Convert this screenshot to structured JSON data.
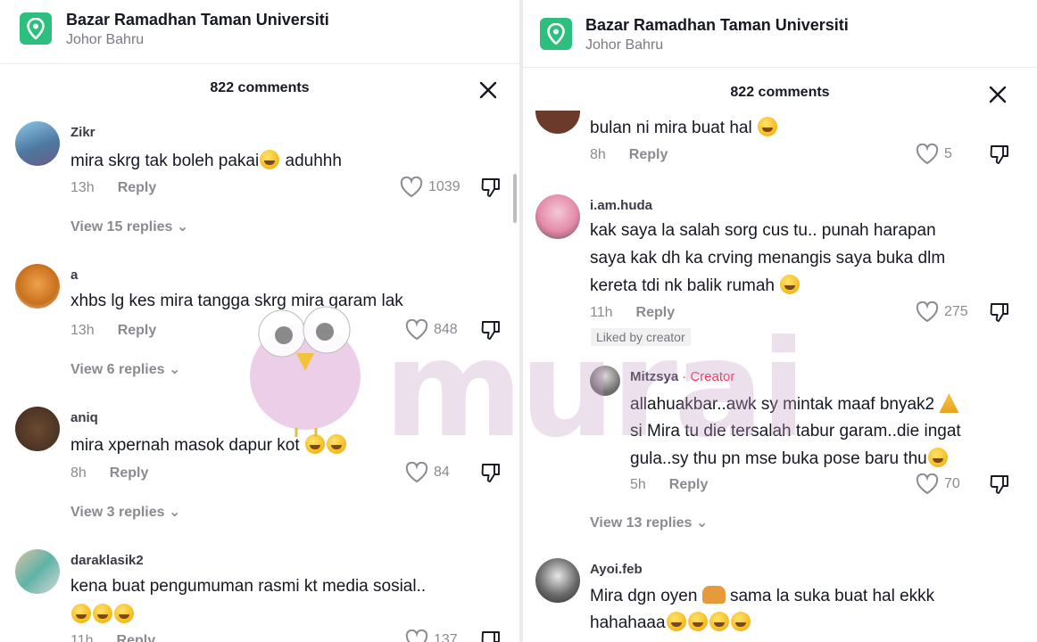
{
  "header": {
    "location_title": "Bazar Ramadhan Taman Universiti",
    "location_subtitle": "Johor Bahru",
    "comments_count": "822 comments"
  },
  "watermark": {
    "text": "murai"
  },
  "left_comments": [
    {
      "username": "Zikr",
      "text": "mira skrg tak boleh pakai",
      "text_after": " aduhhh",
      "time": "13h",
      "reply_label": "Reply",
      "likes": "1039",
      "view_replies": "View 15 replies ⌄"
    },
    {
      "username": "a",
      "text": "xhbs lg kes mira tangga skrg mira garam lak",
      "time": "13h",
      "reply_label": "Reply",
      "likes": "848",
      "view_replies": "View 6 replies ⌄"
    },
    {
      "username": "aniq",
      "text": "mira xpernah masok dapur kot ",
      "time": "8h",
      "reply_label": "Reply",
      "likes": "84",
      "view_replies": "View 3 replies ⌄"
    },
    {
      "username": "daraklasik2",
      "text": "kena buat pengumuman rasmi kt media sosial..",
      "time": "11h",
      "reply_label": "Reply",
      "likes": "137"
    }
  ],
  "right_comments": [
    {
      "text": "bulan ni mira buat hal ",
      "time": "8h",
      "reply_label": "Reply",
      "likes": "5"
    },
    {
      "username": "i.am.huda",
      "line1": "kak saya la salah sorg cus tu.. punah harapan",
      "line2": "saya kak dh ka crving menangis saya buka dlm",
      "line3": "kereta tdi nk balik rumah ",
      "time": "11h",
      "reply_label": "Reply",
      "likes": "275",
      "liked_by": "Liked by creator"
    },
    {
      "username": "Mitzsya",
      "creator_tag": "· Creator",
      "line1": "allahuakbar..awk sy mintak maaf bnyak2 ",
      "line2": "si Mira tu die tersalah tabur garam..die ingat",
      "line3": "gula..sy thu pn mse buka pose baru thu",
      "time": "5h",
      "reply_label": "Reply",
      "likes": "70",
      "view_replies": "View 13 replies ⌄"
    },
    {
      "username": "Ayoi.feb",
      "line1": "Mira dgn oyen ",
      "line1_after": " sama la suka buat hal ekkk",
      "line2": "hahahaaa"
    }
  ],
  "colors": {
    "location_icon": "#2cbf7e",
    "creator": "#fe2c55",
    "muted": "#8a8b91"
  }
}
